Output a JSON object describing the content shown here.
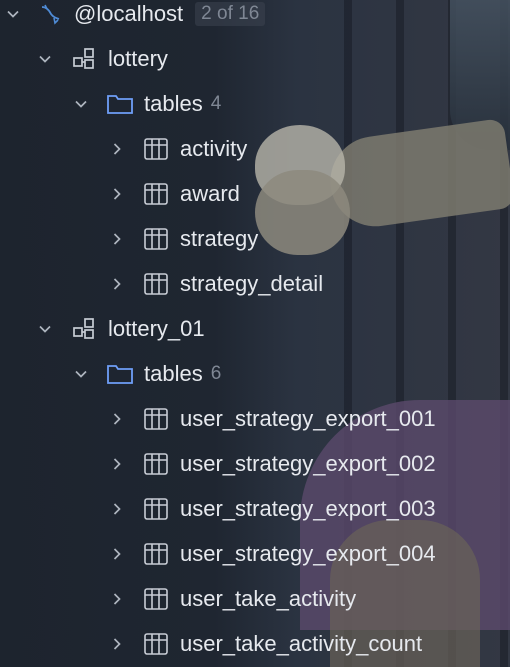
{
  "root": {
    "label": "@localhost",
    "badge": "2 of 16"
  },
  "schemas": [
    {
      "name": "lottery",
      "folder": {
        "label": "tables",
        "count": "4"
      },
      "tables": [
        "activity",
        "award",
        "strategy",
        "strategy_detail"
      ]
    },
    {
      "name": "lottery_01",
      "folder": {
        "label": "tables",
        "count": "6"
      },
      "tables": [
        "user_strategy_export_001",
        "user_strategy_export_002",
        "user_strategy_export_003",
        "user_strategy_export_004",
        "user_take_activity",
        "user_take_activity_count"
      ]
    }
  ],
  "icons": {
    "connection": "mysql-dolphin-icon",
    "schema": "schema-icon",
    "folder": "folder-icon",
    "table": "table-icon",
    "expanded": "chevron-down-icon",
    "collapsed": "chevron-right-icon"
  },
  "colors": {
    "folder_accent": "#6f9ef8",
    "mysql_accent": "#4f8bd6",
    "text": "#e6e9ee",
    "muted": "#7f8794"
  }
}
